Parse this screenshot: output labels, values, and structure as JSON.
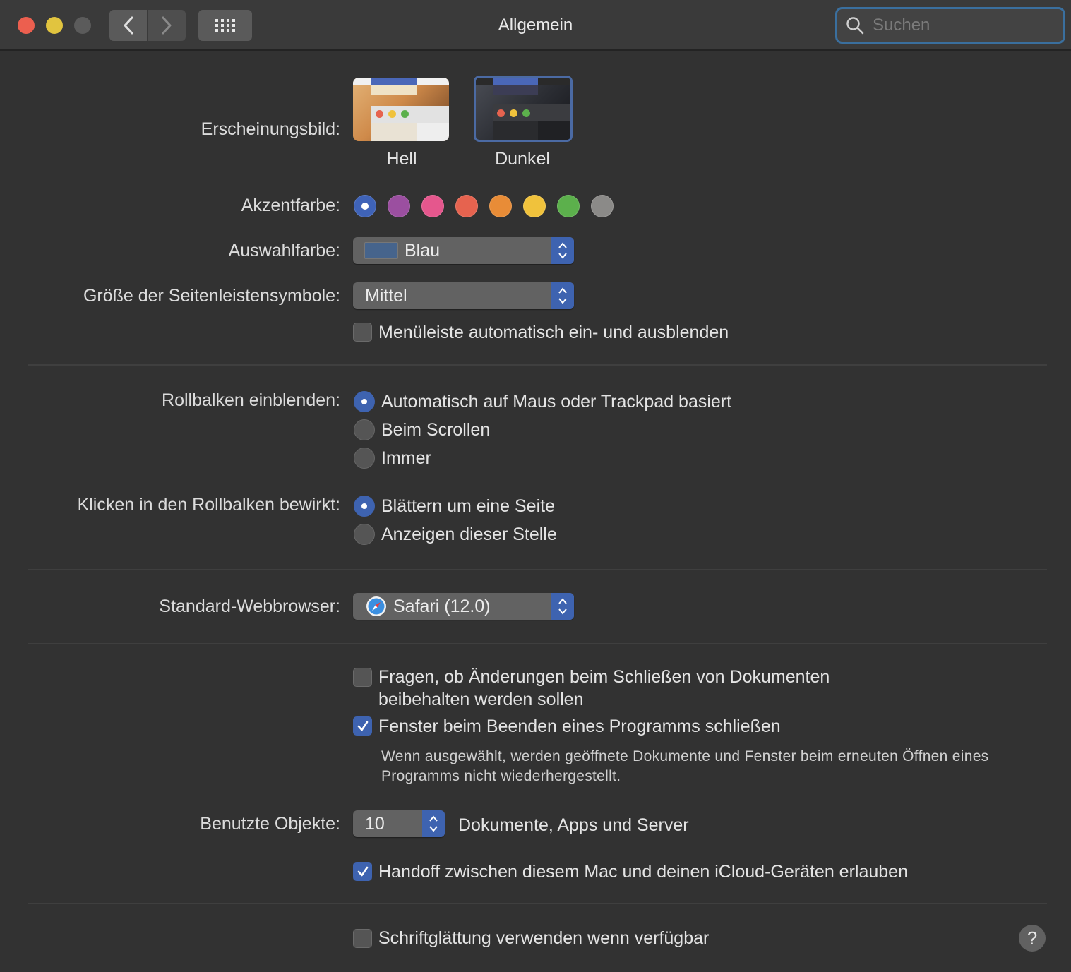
{
  "window": {
    "title": "Allgemein",
    "search_placeholder": "Suchen"
  },
  "appearance": {
    "label": "Erscheinungsbild:",
    "options": [
      "Hell",
      "Dunkel"
    ],
    "selected": "Dunkel"
  },
  "accent": {
    "label": "Akzentfarbe:",
    "colors": [
      "#3f63b8",
      "#9b4fa0",
      "#e5578d",
      "#e6634f",
      "#e88c37",
      "#f0c23c",
      "#5cb04c",
      "#8b8a88"
    ],
    "selected_index": 0
  },
  "highlight": {
    "label": "Auswahlfarbe:",
    "value": "Blau",
    "swatch": "#46648c"
  },
  "sidebar_icon_size": {
    "label": "Größe der Seitenleistensymbole:",
    "value": "Mittel"
  },
  "menubar_autohide": {
    "label": "Menüleiste automatisch ein- und ausblenden",
    "checked": false
  },
  "scrollbars_show": {
    "label": "Rollbalken einblenden:",
    "options": [
      "Automatisch auf Maus oder Trackpad basiert",
      "Beim Scrollen",
      "Immer"
    ],
    "selected": 0
  },
  "scrollbar_click": {
    "label": "Klicken in den Rollbalken bewirkt:",
    "options": [
      "Blättern um eine Seite",
      "Anzeigen dieser Stelle"
    ],
    "selected": 0
  },
  "browser": {
    "label": "Standard-Webbrowser:",
    "value": "Safari (12.0)"
  },
  "ask_keep_changes": {
    "line1": "Fragen, ob Änderungen beim Schließen von Dokumenten",
    "line2": "beibehalten werden sollen",
    "checked": false
  },
  "close_windows": {
    "label": "Fenster beim Beenden eines Programms schließen",
    "checked": true,
    "note_line1": "Wenn ausgewählt, werden geöffnete Dokumente und Fenster beim erneuten Öffnen eines",
    "note_line2": "Programms nicht wiederhergestellt."
  },
  "recent_items": {
    "label": "Benutzte Objekte:",
    "value": "10",
    "suffix": "Dokumente, Apps und Server"
  },
  "handoff": {
    "label": "Handoff zwischen diesem Mac und deinen iCloud-Geräten erlauben",
    "checked": true
  },
  "font_smoothing": {
    "label": "Schriftglättung verwenden wenn verfügbar",
    "checked": false
  },
  "help_label": "?"
}
